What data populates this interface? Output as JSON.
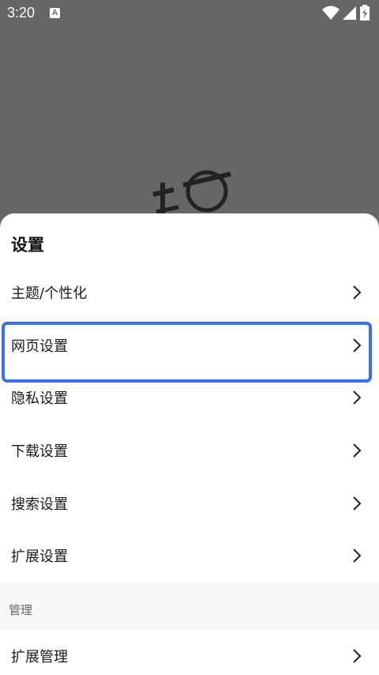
{
  "status_bar": {
    "time": "3:20",
    "notification_badge": "A",
    "icons": [
      "wifi-icon",
      "signal-icon",
      "battery-charging-icon"
    ]
  },
  "settings_sheet": {
    "title": "设置",
    "items": [
      {
        "label": "主题/个性化"
      },
      {
        "label": "网页设置",
        "highlighted": true
      },
      {
        "label": "隐私设置"
      },
      {
        "label": "下载设置"
      },
      {
        "label": "搜索设置"
      },
      {
        "label": "扩展设置"
      }
    ],
    "section_manage": {
      "label": "管理",
      "items": [
        {
          "label": "扩展管理"
        }
      ]
    }
  },
  "colors": {
    "overlay": "#666666",
    "sheet_bg": "#ffffff",
    "highlight": "#3a6ff0",
    "section_bg": "#f7f7f7"
  }
}
